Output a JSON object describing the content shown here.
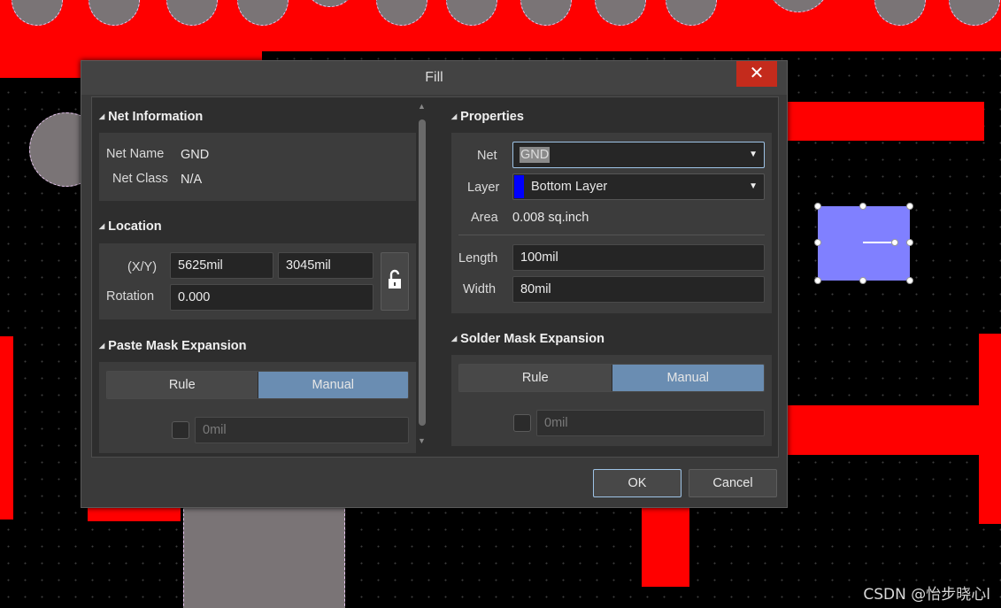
{
  "dialog": {
    "title": "Fill",
    "close_symbol": "✕"
  },
  "net_information": {
    "title": "Net Information",
    "net_name_label": "Net Name",
    "net_name_value": "GND",
    "net_class_label": "Net Class",
    "net_class_value": "N/A"
  },
  "location": {
    "title": "Location",
    "xy_label": "(X/Y)",
    "x_value": "5625mil",
    "y_value": "3045mil",
    "rotation_label": "Rotation",
    "rotation_value": "0.000"
  },
  "paste_mask": {
    "title": "Paste Mask Expansion",
    "rule_label": "Rule",
    "manual_label": "Manual",
    "value": "0mil",
    "selected": "Manual"
  },
  "properties": {
    "title": "Properties",
    "net_label": "Net",
    "net_value": "GND",
    "layer_label": "Layer",
    "layer_value": "Bottom Layer",
    "layer_color": "#0000ff",
    "area_label": "Area",
    "area_value": "0.008 sq.inch",
    "length_label": "Length",
    "length_value": "100mil",
    "width_label": "Width",
    "width_value": "80mil"
  },
  "solder_mask": {
    "title": "Solder Mask Expansion",
    "rule_label": "Rule",
    "manual_label": "Manual",
    "value": "0mil",
    "selected": "Manual"
  },
  "buttons": {
    "ok_label": "OK",
    "cancel_label": "Cancel"
  },
  "watermark": "CSDN @怡步晓心l",
  "icons": {
    "close": "close-icon",
    "lock": "unlock-icon",
    "collapse": "collapse-triangle-icon",
    "dropdown": "chevron-down-icon"
  },
  "colors": {
    "copper_top": "#ff0000",
    "selected_fill": "#8080ff",
    "accent": "#6a8db2",
    "close": "#c42b1c"
  }
}
